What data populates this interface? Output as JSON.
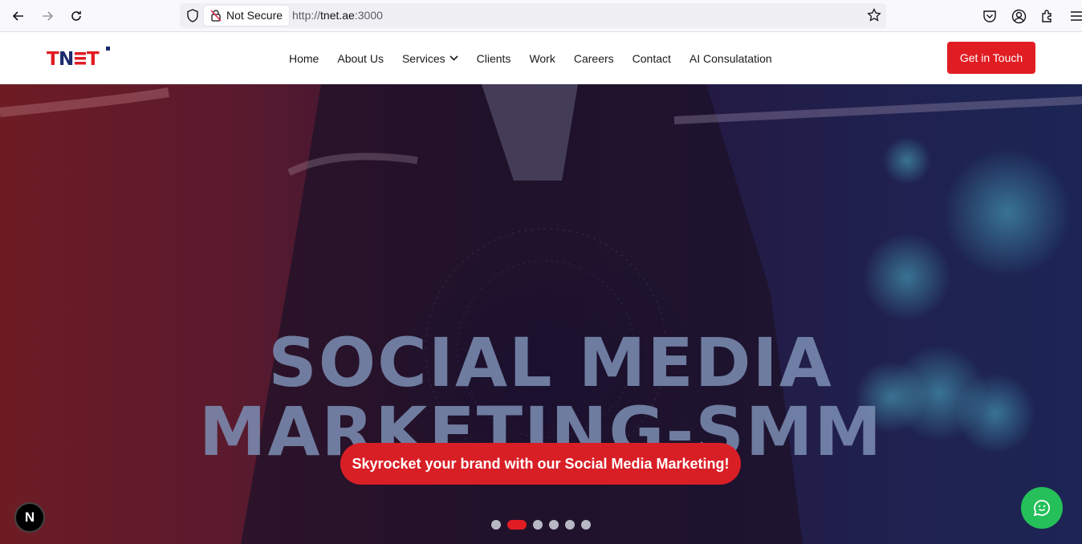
{
  "browser": {
    "not_secure_label": "Not Secure",
    "url_prefix": "http://",
    "url_host": "tnet.ae",
    "url_suffix": ":3000",
    "icons": [
      "back-icon",
      "forward-icon",
      "reload-icon",
      "shield-icon",
      "insecure-lock-icon",
      "star-icon",
      "pocket-icon",
      "account-icon",
      "extensions-icon",
      "menu-icon"
    ]
  },
  "site": {
    "logo_text": "TNET",
    "nav": {
      "home": "Home",
      "about": "About Us",
      "services": "Services",
      "clients": "Clients",
      "work": "Work",
      "careers": "Careers",
      "contact": "Contact",
      "ai": "AI Consulatation"
    },
    "cta": "Get in Touch",
    "brand_color": "#e11d24"
  },
  "hero": {
    "line1": "SOCIAL MEDIA",
    "line2": "MARKETING-SMM",
    "button": "Skyrocket your brand with our Social Media Marketing!",
    "slide_count": 6,
    "active_slide": 2
  },
  "widgets": {
    "next_badge": "N",
    "chat_icon": "chat-smile-icon",
    "chat_color": "#25c05a"
  }
}
